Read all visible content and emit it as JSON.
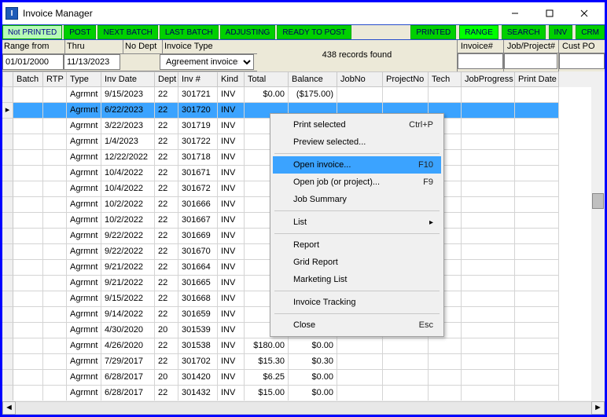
{
  "window": {
    "title": "Invoice Manager"
  },
  "toolbar": {
    "not_printed": "Not PRINTED",
    "post": "POST",
    "next_batch": "NEXT BATCH",
    "last_batch": "LAST BATCH",
    "adjusting": "ADJUSTING",
    "ready_to_post": "READY TO POST",
    "printed": "PRINTED",
    "range": "RANGE",
    "search": "SEARCH",
    "inv": "INV",
    "crm": "CRM"
  },
  "filters": {
    "range_from_lbl": "Range from",
    "range_from_val": "01/01/2000",
    "thru_lbl": "Thru",
    "thru_val": "11/13/2023",
    "nodept_lbl": "No Dept",
    "invoice_type_lbl": "Invoice Type",
    "invoice_type_val": "Agreement invoices",
    "records_found": "438 records found",
    "invoice_no_lbl": "Invoice#",
    "jobproj_lbl": "Job/Project#",
    "custpo_lbl": "Cust PO"
  },
  "columns": {
    "batch": "Batch",
    "rtp": "RTP",
    "type": "Type",
    "invdate": "Inv Date",
    "dept": "Dept",
    "invnum": "Inv #",
    "kind": "Kind",
    "total": "Total",
    "balance": "Balance",
    "jobno": "JobNo",
    "projno": "ProjectNo",
    "tech": "Tech",
    "jobprog": "JobProgress",
    "printdate": "Print Date"
  },
  "rows": [
    {
      "type": "Agrmnt",
      "date": "9/15/2023",
      "dept": "22",
      "num": "301721",
      "kind": "INV",
      "total": "$0.00",
      "balance": "($175.00)"
    },
    {
      "type": "Agrmnt",
      "date": "6/22/2023",
      "dept": "22",
      "num": "301720",
      "kind": "INV",
      "total": "",
      "balance": "",
      "selected": true,
      "current": true
    },
    {
      "type": "Agrmnt",
      "date": "3/22/2023",
      "dept": "22",
      "num": "301719",
      "kind": "INV"
    },
    {
      "type": "Agrmnt",
      "date": "1/4/2023",
      "dept": "22",
      "num": "301722",
      "kind": "INV"
    },
    {
      "type": "Agrmnt",
      "date": "12/22/2022",
      "dept": "22",
      "num": "301718",
      "kind": "INV"
    },
    {
      "type": "Agrmnt",
      "date": "10/4/2022",
      "dept": "22",
      "num": "301671",
      "kind": "INV"
    },
    {
      "type": "Agrmnt",
      "date": "10/4/2022",
      "dept": "22",
      "num": "301672",
      "kind": "INV"
    },
    {
      "type": "Agrmnt",
      "date": "10/2/2022",
      "dept": "22",
      "num": "301666",
      "kind": "INV"
    },
    {
      "type": "Agrmnt",
      "date": "10/2/2022",
      "dept": "22",
      "num": "301667",
      "kind": "INV"
    },
    {
      "type": "Agrmnt",
      "date": "9/22/2022",
      "dept": "22",
      "num": "301669",
      "kind": "INV"
    },
    {
      "type": "Agrmnt",
      "date": "9/22/2022",
      "dept": "22",
      "num": "301670",
      "kind": "INV"
    },
    {
      "type": "Agrmnt",
      "date": "9/21/2022",
      "dept": "22",
      "num": "301664",
      "kind": "INV"
    },
    {
      "type": "Agrmnt",
      "date": "9/21/2022",
      "dept": "22",
      "num": "301665",
      "kind": "INV"
    },
    {
      "type": "Agrmnt",
      "date": "9/15/2022",
      "dept": "22",
      "num": "301668",
      "kind": "INV"
    },
    {
      "type": "Agrmnt",
      "date": "9/14/2022",
      "dept": "22",
      "num": "301659",
      "kind": "INV"
    },
    {
      "type": "Agrmnt",
      "date": "4/30/2020",
      "dept": "20",
      "num": "301539",
      "kind": "INV"
    },
    {
      "type": "Agrmnt",
      "date": "4/26/2020",
      "dept": "22",
      "num": "301538",
      "kind": "INV",
      "total": "$180.00",
      "balance": "$0.00"
    },
    {
      "type": "Agrmnt",
      "date": "7/29/2017",
      "dept": "22",
      "num": "301702",
      "kind": "INV",
      "total": "$15.30",
      "balance": "$0.30"
    },
    {
      "type": "Agrmnt",
      "date": "6/28/2017",
      "dept": "20",
      "num": "301420",
      "kind": "INV",
      "total": "$6.25",
      "balance": "$0.00"
    },
    {
      "type": "Agrmnt",
      "date": "6/28/2017",
      "dept": "22",
      "num": "301432",
      "kind": "INV",
      "total": "$15.00",
      "balance": "$0.00"
    }
  ],
  "context_menu": {
    "print_selected": "Print selected",
    "print_sc": "Ctrl+P",
    "preview_selected": "Preview selected...",
    "open_invoice": "Open invoice...",
    "open_invoice_sc": "F10",
    "open_job": "Open job (or project)...",
    "open_job_sc": "F9",
    "job_summary": "Job Summary",
    "list": "List",
    "report": "Report",
    "grid_report": "Grid Report",
    "marketing_list": "Marketing List",
    "invoice_tracking": "Invoice Tracking",
    "close": "Close",
    "close_sc": "Esc"
  }
}
